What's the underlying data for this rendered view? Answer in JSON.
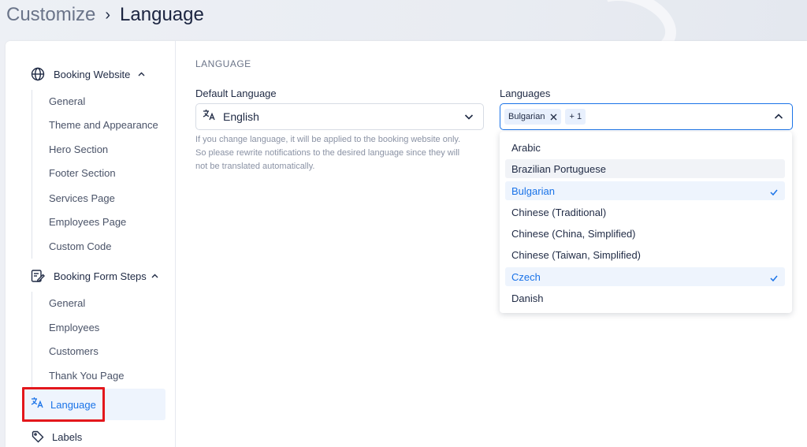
{
  "breadcrumb": {
    "parent": "Customize",
    "separator": "›",
    "current": "Language"
  },
  "sidebar": {
    "booking_website": {
      "label": "Booking Website",
      "items": [
        "General",
        "Theme and Appearance",
        "Hero Section",
        "Footer Section",
        "Services Page",
        "Employees Page",
        "Custom Code"
      ]
    },
    "booking_form_steps": {
      "label": "Booking Form Steps",
      "items": [
        "General",
        "Employees",
        "Customers",
        "Thank You Page"
      ]
    },
    "language": {
      "label": "Language"
    },
    "labels": {
      "label": "Labels"
    }
  },
  "main": {
    "section_title": "LANGUAGE",
    "default_language": {
      "label": "Default Language",
      "value": "English",
      "help_lines": [
        "If you change language, it will be applied to the booking website only.",
        "So please rewrite notifications to the desired language since they will",
        "not be translated automatically."
      ]
    },
    "languages": {
      "label": "Languages",
      "chip": "Bulgarian",
      "more": "+ 1",
      "options": [
        {
          "label": "Arabic",
          "state": "normal"
        },
        {
          "label": "Brazilian Portuguese",
          "state": "hover"
        },
        {
          "label": "Bulgarian",
          "state": "selected"
        },
        {
          "label": "Chinese (Traditional)",
          "state": "normal"
        },
        {
          "label": "Chinese (China, Simplified)",
          "state": "normal"
        },
        {
          "label": "Chinese (Taiwan, Simplified)",
          "state": "normal"
        },
        {
          "label": "Czech",
          "state": "selected"
        },
        {
          "label": "Danish",
          "state": "normal"
        }
      ]
    }
  },
  "colors": {
    "accent": "#1a73e8",
    "highlight": "#e3171c",
    "text": "#1f2a44",
    "muted": "#8a92a4"
  },
  "icons": {
    "booking_website": "globe-icon",
    "booking_form_steps": "form-edit-icon",
    "language": "translate-icon",
    "labels": "tag-icon",
    "collapse": "chevron-up-icon",
    "chip_remove": "close-icon",
    "check": "check-icon"
  }
}
